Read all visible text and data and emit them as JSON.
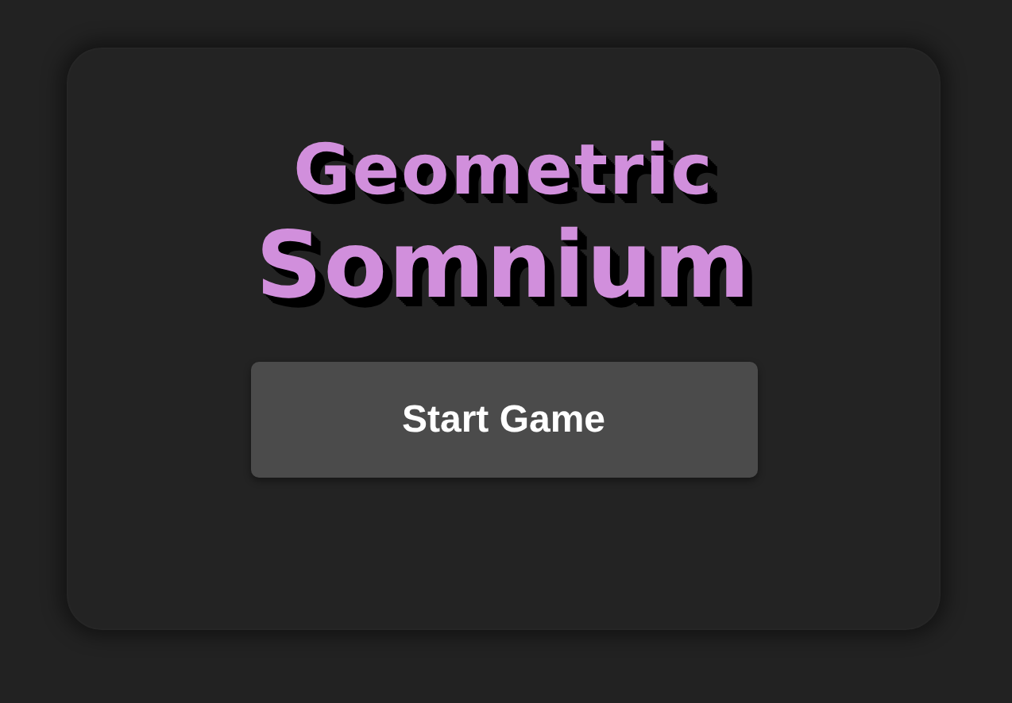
{
  "title": {
    "line_1": "Geometric",
    "line_2": "Somnium"
  },
  "buttons": [
    {
      "label": "Start Game"
    }
  ]
}
